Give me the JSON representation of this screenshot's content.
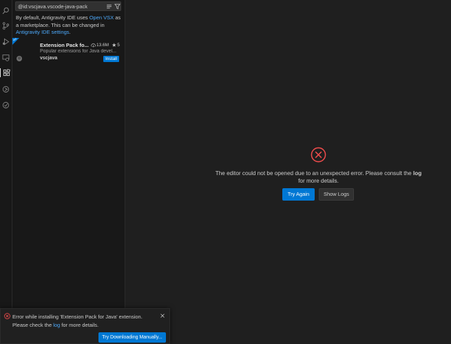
{
  "search": {
    "value": "@id:vscjava.vscode-java-pack"
  },
  "notice": {
    "part1": "By default, Antigravity IDE uses ",
    "link1": "Open VSX",
    "part2": " as a marketplace. This can be changed in ",
    "link2": "Antigravity IDE settings",
    "part3": "."
  },
  "extension": {
    "name": "Extension Pack fo...",
    "downloads": "13.6M",
    "rating": "5",
    "description": "Popular extensions for Java devel...",
    "publisher": "vscjava",
    "install_label": "Install"
  },
  "editor": {
    "error_part1": "The editor could not be opened due to an unexpected error. Please consult the ",
    "error_link": "log",
    "error_part2": " for more details.",
    "try_again_label": "Try Again",
    "show_logs_label": "Show Logs"
  },
  "toast": {
    "line1": "Error while installing 'Extension Pack for Java' extension.",
    "line2_part1": "Please check the ",
    "line2_link": "log",
    "line2_part2": " for more details.",
    "action_label": "Try Downloading Manually..."
  },
  "colors": {
    "accent": "#0078d4",
    "error": "#f14c4c",
    "link": "#4daafc"
  }
}
